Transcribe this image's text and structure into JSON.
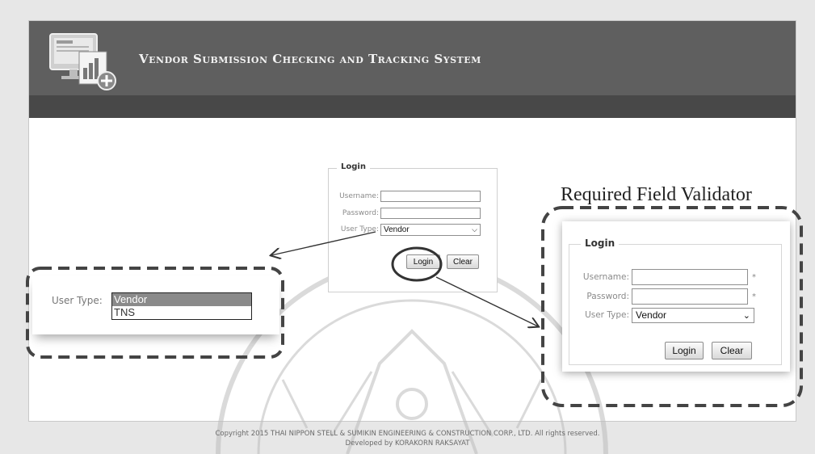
{
  "header": {
    "title": "Vendor Submission Checking and Tracking System"
  },
  "login_form": {
    "legend": "Login",
    "username_label": "Username:",
    "password_label": "Password:",
    "usertype_label": "User Type:",
    "usertype_value": "Vendor",
    "login_button": "Login",
    "clear_button": "Clear"
  },
  "callout_dropdown": {
    "label": "User Type:",
    "options": [
      "Vendor",
      "TNS"
    ],
    "selected": "Vendor"
  },
  "callout_validator": {
    "title": "Required Field Validator",
    "legend": "Login",
    "username_label": "Username:",
    "password_label": "Password:",
    "usertype_label": "User Type:",
    "usertype_value": "Vendor",
    "required_marker": "*",
    "login_button": "Login",
    "clear_button": "Clear"
  },
  "footer": {
    "copyright": "Copyright 2015 THAI NIPPON STELL & SUMIKIN ENGINEERING & CONSTRUCTION CORP., LTD. All rights reserved.",
    "developer": "Developed by KORAKORN RAKSAYAT"
  },
  "colors": {
    "header_bg": "#5f5f5f",
    "subbar_bg": "#484848",
    "selected_option_bg": "#8a8a8a"
  }
}
